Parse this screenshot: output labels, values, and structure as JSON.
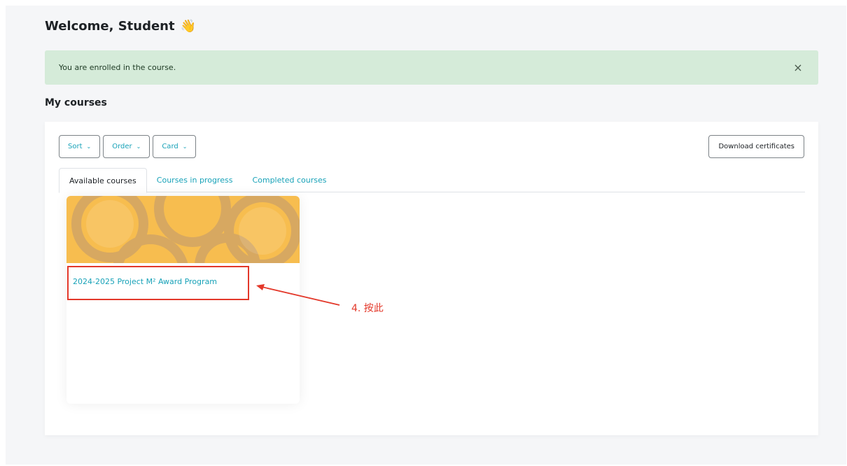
{
  "welcome": {
    "text": "Welcome, Student",
    "emoji": "👋"
  },
  "alert": {
    "message": "You are enrolled in the course.",
    "close_glyph": "×"
  },
  "section_title": "My courses",
  "controls": {
    "sort_label": "Sort",
    "order_label": "Order",
    "view_label": "Card",
    "download_label": "Download certificates"
  },
  "tabs": [
    {
      "label": "Available courses",
      "active": true
    },
    {
      "label": "Courses in progress",
      "active": false
    },
    {
      "label": "Completed courses",
      "active": false
    }
  ],
  "course": {
    "name": "2024-2025 Project M² Award Program"
  },
  "annotation": {
    "label": "4. 按此"
  },
  "colors": {
    "accent": "#18a2b8",
    "alert_bg": "#d5ebd9",
    "annotation": "#e3382a",
    "course_image": "#f5b94a"
  }
}
